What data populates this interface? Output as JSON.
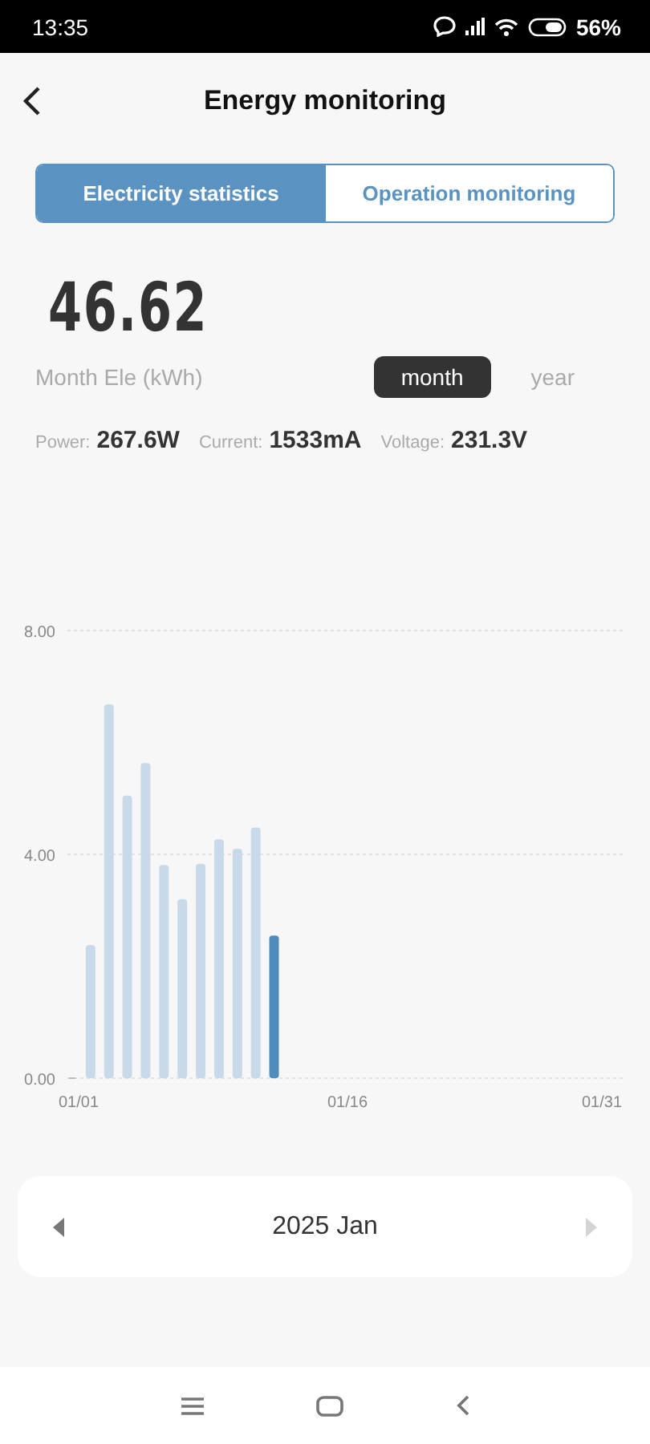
{
  "status_bar": {
    "time": "13:35",
    "battery": "56%"
  },
  "header": {
    "title": "Energy monitoring"
  },
  "tabs": [
    {
      "label": "Electricity statistics",
      "selected": true
    },
    {
      "label": "Operation monitoring",
      "selected": false
    }
  ],
  "summary": {
    "value": "46.62",
    "label": "Month Ele (kWh)"
  },
  "periods": [
    {
      "label": "month",
      "selected": true
    },
    {
      "label": "year",
      "selected": false
    }
  ],
  "readings": [
    {
      "label": "Power:",
      "value": "267.6W"
    },
    {
      "label": "Current:",
      "value": "1533mA"
    },
    {
      "label": "Voltage:",
      "value": "231.3V"
    }
  ],
  "chart_data": {
    "type": "bar",
    "categories": [
      "01/01",
      null,
      null,
      null,
      null,
      null,
      null,
      null,
      null,
      null,
      null,
      null,
      null,
      null,
      null,
      "01/16",
      null,
      null,
      null,
      null,
      null,
      null,
      null,
      null,
      null,
      null,
      null,
      null,
      null,
      null,
      "01/31"
    ],
    "series": [
      {
        "color": "#c8dae9",
        "values": [
          0,
          2.38,
          6.68,
          5.05,
          5.63,
          3.81,
          3.2,
          3.83,
          4.27,
          4.1,
          4.48,
          null,
          null,
          null,
          null,
          null,
          null,
          null,
          null,
          null,
          null,
          null,
          null,
          null,
          null,
          null,
          null,
          null,
          null,
          null,
          null
        ]
      },
      {
        "color": "#4e8cbd",
        "values": [
          null,
          null,
          null,
          null,
          null,
          null,
          null,
          null,
          null,
          null,
          null,
          2.55,
          null,
          null,
          null,
          null,
          null,
          null,
          null,
          null,
          null,
          null,
          null,
          null,
          null,
          null,
          null,
          null,
          null,
          null,
          null
        ]
      }
    ],
    "ylim": [
      0,
      8
    ],
    "yticks": [
      {
        "value": 0,
        "label": "0.00"
      },
      {
        "value": 4,
        "label": "4.00"
      },
      {
        "value": 8,
        "label": "8.00"
      }
    ]
  },
  "date_selector": {
    "label": "2025 Jan",
    "next_disabled": true
  }
}
